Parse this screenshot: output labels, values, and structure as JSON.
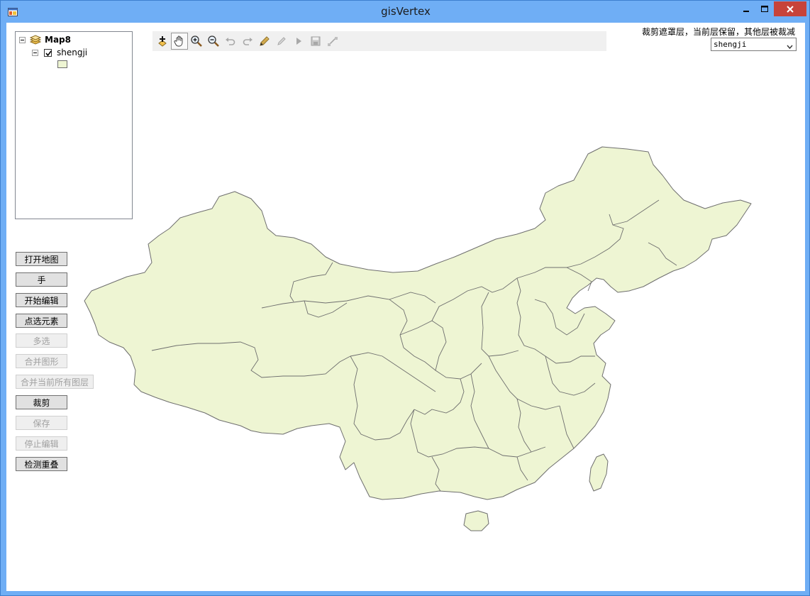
{
  "window": {
    "title": "gisVertex"
  },
  "toc": {
    "map_name": "Map8",
    "layer_name": "shengji",
    "layer_checked": true
  },
  "toolbar": {
    "tools": [
      {
        "name": "add-data-icon",
        "enabled": true
      },
      {
        "name": "pan-hand-icon",
        "enabled": true,
        "active": true
      },
      {
        "name": "zoom-in-icon",
        "enabled": true
      },
      {
        "name": "zoom-out-icon",
        "enabled": true
      },
      {
        "name": "undo-icon",
        "enabled": false
      },
      {
        "name": "redo-icon",
        "enabled": false
      },
      {
        "name": "edit-pencil-icon",
        "enabled": true
      },
      {
        "name": "sketch-icon",
        "enabled": false
      },
      {
        "name": "select-arrow-icon",
        "enabled": false
      },
      {
        "name": "save-edits-icon",
        "enabled": false
      },
      {
        "name": "vertex-tool-icon",
        "enabled": false
      }
    ]
  },
  "clip": {
    "label": "裁剪遮罩层，当前层保留，其他层被裁减",
    "selected_layer": "shengji"
  },
  "buttons": [
    {
      "label": "打开地图",
      "enabled": true
    },
    {
      "label": "手",
      "enabled": true
    },
    {
      "label": "开始编辑",
      "enabled": true
    },
    {
      "label": "点选元素",
      "enabled": true
    },
    {
      "label": "多选",
      "enabled": false
    },
    {
      "label": "合并图形",
      "enabled": false
    },
    {
      "label": "合并当前所有图层",
      "enabled": false
    },
    {
      "label": "裁剪",
      "enabled": true
    },
    {
      "label": "保存",
      "enabled": false
    },
    {
      "label": "停止编辑",
      "enabled": false
    },
    {
      "label": "检测重叠",
      "enabled": true
    }
  ],
  "colors": {
    "titlebar": "#6faef5",
    "close_button": "#c7433a",
    "map_fill": "#eef5d3",
    "map_outline": "#6e6e6e"
  }
}
